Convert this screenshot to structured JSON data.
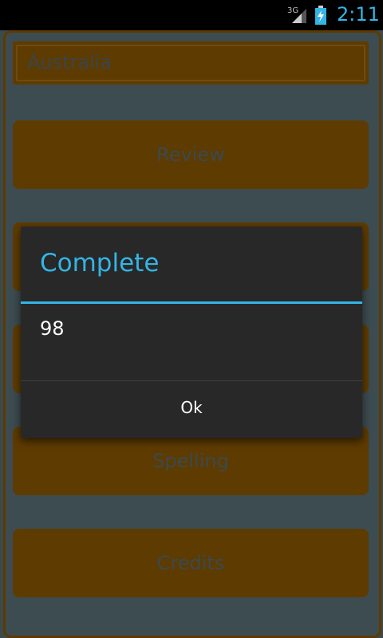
{
  "status_bar": {
    "network_type": "3G",
    "time": "2:11",
    "time_color": "#33b5e5"
  },
  "country_field": {
    "value": "Australia"
  },
  "buttons": [
    {
      "label": "Review"
    },
    {
      "label": ""
    },
    {
      "label": ""
    },
    {
      "label": "Spelling"
    },
    {
      "label": "Credits"
    }
  ],
  "dialog": {
    "title": "Complete",
    "message": "98",
    "ok_label": "Ok"
  },
  "colors": {
    "accent": "#33b5e5",
    "button_bg": "#5e3b00",
    "app_bg": "#3d4c50",
    "dialog_bg": "#282828"
  }
}
